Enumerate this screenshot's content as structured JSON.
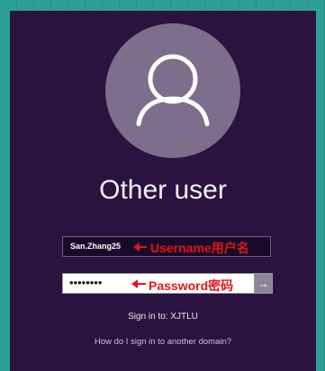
{
  "user": {
    "heading": "Other user",
    "username_value": "San.Zhang25",
    "password_masked": "••••••••"
  },
  "annotations": {
    "username": "Username用户名",
    "password": "Password密码"
  },
  "submit": {
    "icon": "arrow-right-icon",
    "glyph": "→"
  },
  "footer": {
    "sign_in_to": "Sign in to: XJTLU",
    "another_domain_link": "How do I sign in to another domain?"
  },
  "colors": {
    "panel": "#2a133f",
    "avatar_circle": "#7d6f8b",
    "annotation_red": "#e0161c",
    "background_teal": "#2a9a93"
  }
}
